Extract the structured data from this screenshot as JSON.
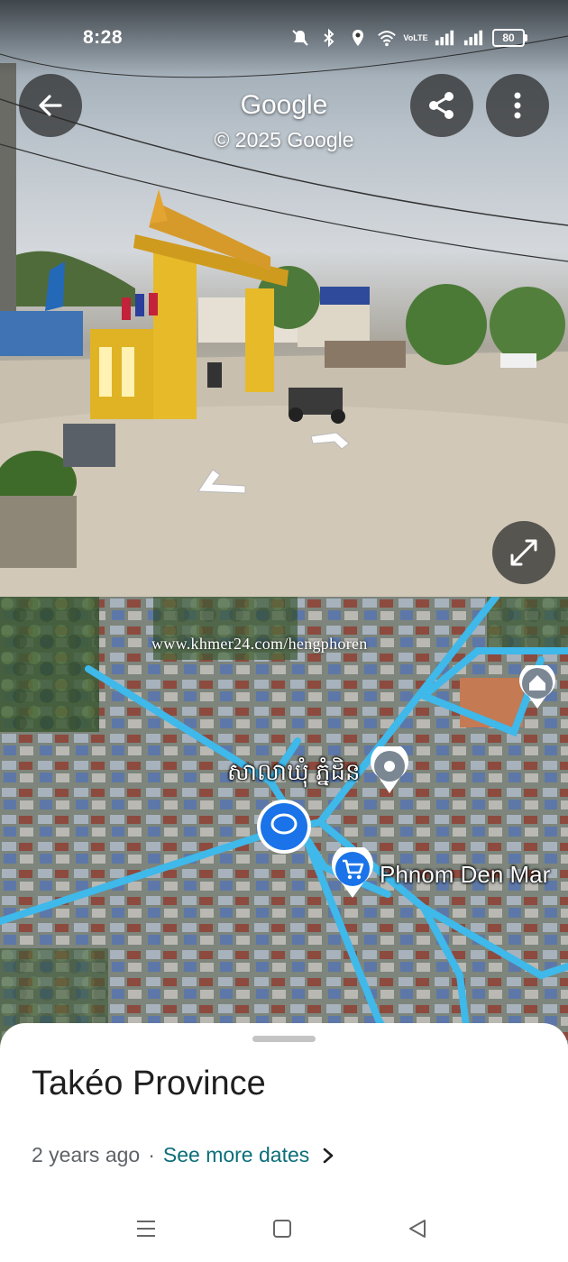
{
  "status_bar": {
    "time": "8:28",
    "network_label": "VoLTE",
    "battery": "80",
    "icons": [
      "mute-icon",
      "bluetooth-icon",
      "location-icon",
      "wifi-icon",
      "volte-icon",
      "signal-icon",
      "signal-icon",
      "battery-icon"
    ]
  },
  "street_view": {
    "title": "Google",
    "copyright": "© 2025 Google",
    "back_icon": "arrow-left-icon",
    "share_icon": "share-icon",
    "more_icon": "more-vert-icon",
    "expand_icon": "expand-icon"
  },
  "map": {
    "watermark": "www.khmer24.com/hengphoren",
    "labels": {
      "commune_hall": "សាលាឃុំ ភ្នំដិន",
      "market": "Phnom Den Mar"
    },
    "colors": {
      "road": "#3fb8ea",
      "pin_blue": "#1a73e8"
    }
  },
  "sheet": {
    "title": "Takéo Province",
    "age": "2 years ago",
    "separator": "·",
    "see_more": "See more dates"
  },
  "nav_bar": {
    "icons": [
      "menu-icon",
      "home-square-icon",
      "back-triangle-icon"
    ]
  }
}
